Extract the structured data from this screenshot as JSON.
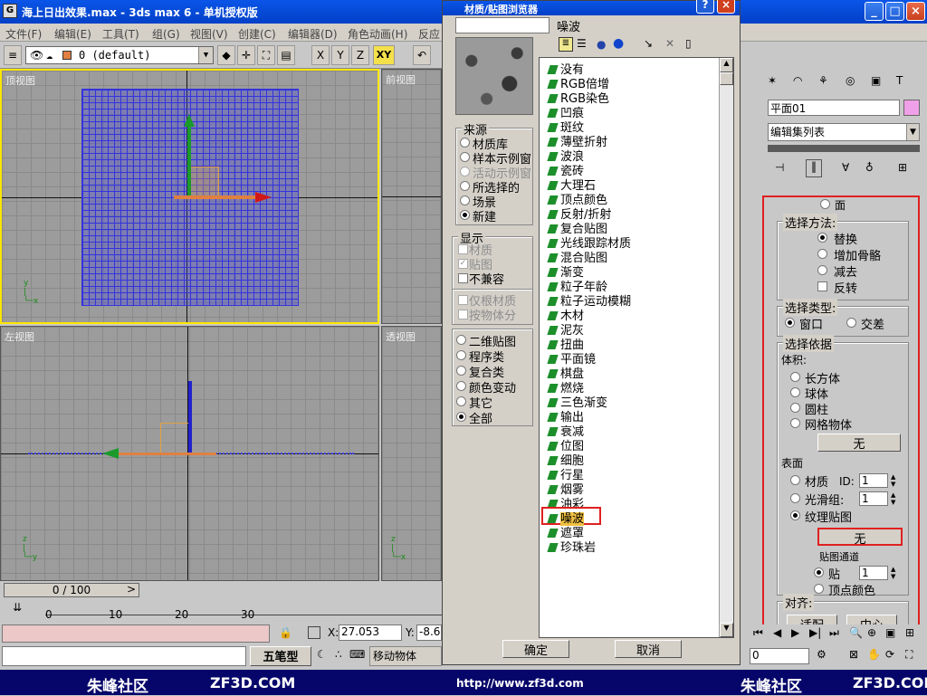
{
  "app": {
    "title": "海上日出效果.max - 3ds max 6 - 单机授权版",
    "menu": [
      "文件(F)",
      "编辑(E)",
      "工具(T)",
      "组(G)",
      "视图(V)",
      "创建(C)",
      "编辑器(D)",
      "角色动画(H)",
      "反应"
    ],
    "layer_value": "0 (default)",
    "axis_buttons": [
      "X",
      "Y",
      "Z",
      "XY"
    ],
    "view_select": "视图"
  },
  "viewports": {
    "top": "顶视图",
    "front": "前视图",
    "left": "左视图",
    "persp": "透视图"
  },
  "timeline": {
    "frame_label": "0 / 100",
    "ticks": [
      "0",
      "10",
      "20",
      "30"
    ]
  },
  "status": {
    "x_label": "X:",
    "x_value": "27.053",
    "y_label": "Y:",
    "y_value": "-8.6",
    "wubi": "五笔型",
    "prompt": "移动物体",
    "frame_field": "0"
  },
  "watermark": {
    "left_brand": "朱峰社区",
    "left_url": "ZF3D.COM",
    "center_url": "http://www.zf3d.com",
    "right_brand": "朱峰社区",
    "right_url": "ZF3D.COM"
  },
  "dialog": {
    "title": "材质/贴图浏览器",
    "name_field": "",
    "current_map": "噪波",
    "source_title": "来源",
    "source_items": [
      {
        "label": "材质库",
        "selected": false,
        "disabled": false
      },
      {
        "label": "样本示例窗",
        "selected": false,
        "disabled": false
      },
      {
        "label": "活动示例窗",
        "selected": false,
        "disabled": true
      },
      {
        "label": "所选择的",
        "selected": false,
        "disabled": false
      },
      {
        "label": "场景",
        "selected": false,
        "disabled": false
      },
      {
        "label": "新建",
        "selected": true,
        "disabled": false
      }
    ],
    "display_title": "显示",
    "display_items": [
      {
        "label": "材质",
        "checked": false,
        "disabled": true
      },
      {
        "label": "贴图",
        "checked": true,
        "disabled": true
      },
      {
        "label": "不兼容",
        "checked": false,
        "disabled": false
      }
    ],
    "root_items": [
      {
        "label": "仅根材质",
        "checked": false
      },
      {
        "label": "按物体分",
        "checked": false
      }
    ],
    "category_items": [
      {
        "label": "二维贴图",
        "selected": false
      },
      {
        "label": "程序类",
        "selected": false
      },
      {
        "label": "复合类",
        "selected": false
      },
      {
        "label": "颜色变动",
        "selected": false
      },
      {
        "label": "其它",
        "selected": false
      },
      {
        "label": "全部",
        "selected": true
      }
    ],
    "maps": [
      "没有",
      "RGB倍增",
      "RGB染色",
      "凹痕",
      "斑纹",
      "薄壁折射",
      "波浪",
      "瓷砖",
      "大理石",
      "顶点颜色",
      "反射/折射",
      "复合贴图",
      "光线跟踪材质",
      "混合贴图",
      "渐变",
      "粒子年龄",
      "粒子运动模糊",
      "木材",
      "泥灰",
      "扭曲",
      "平面镜",
      "棋盘",
      "燃烧",
      "三色渐变",
      "输出",
      "衰减",
      "位图",
      "细胞",
      "行星",
      "烟雾",
      "油彩",
      "噪波",
      "遮罩",
      "珍珠岩"
    ],
    "selected_map": "噪波",
    "ok": "确定",
    "cancel": "取消"
  },
  "panel": {
    "object_name": "平面01",
    "modifier_list": "编辑集列表",
    "face_label": "面",
    "select_method_title": "选择方法:",
    "select_method": [
      {
        "label": "替换",
        "selected": true
      },
      {
        "label": "增加骨骼",
        "selected": false
      },
      {
        "label": "减去",
        "selected": false
      }
    ],
    "invert_label": "反转",
    "select_type_title": "选择类型:",
    "select_type": [
      {
        "label": "窗口",
        "selected": true
      },
      {
        "label": "交差",
        "selected": false
      }
    ],
    "select_by_title": "选择依据",
    "volume_label": "体积:",
    "volume_items": [
      "长方体",
      "球体",
      "圆柱",
      "网格物体"
    ],
    "none_btn_1": "无",
    "surface_label": "表面",
    "material_label": "材质",
    "id_label": "ID:",
    "id_value": "1",
    "smooth_label": "光滑组:",
    "smooth_value": "1",
    "texture_label": "纹理贴图",
    "none_btn_2": "无",
    "map_channel_label": "贴图通道",
    "map_label": "贴",
    "map_value": "1",
    "vertex_color_label": "顶点颜色",
    "align_label": "对齐:",
    "fit_label": "适配",
    "center_label": "中心"
  },
  "colors": {
    "title_blue": "#0a55e8",
    "highlight_red": "#e02020",
    "viewport_active": "#ffe600"
  }
}
